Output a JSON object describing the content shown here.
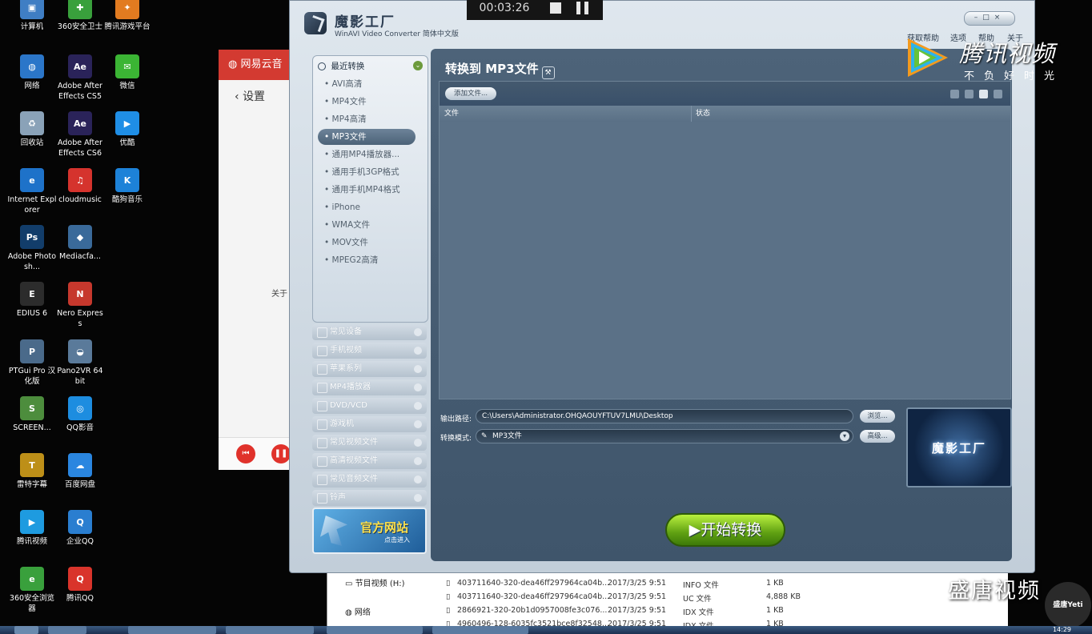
{
  "desktop": {
    "icons": [
      {
        "label": "计算机",
        "color": "#3f7ec4",
        "glyph": "▣"
      },
      {
        "label": "360安全卫士",
        "color": "#39a03c",
        "glyph": "✚"
      },
      {
        "label": "腾讯游戏平台",
        "color": "#e27b20",
        "glyph": "✦"
      },
      {
        "label": "网络",
        "color": "#2b76c9",
        "glyph": "◍"
      },
      {
        "label": "Adobe After Effects CS5",
        "color": "#2a2359",
        "glyph": "Ae"
      },
      {
        "label": "微信",
        "color": "#3bb534",
        "glyph": "✉"
      },
      {
        "label": "回收站",
        "color": "#8aa2b8",
        "glyph": "♻"
      },
      {
        "label": "Adobe After Effects CS6",
        "color": "#2a2359",
        "glyph": "Ae"
      },
      {
        "label": "优酷",
        "color": "#1f8ee6",
        "glyph": "▶"
      },
      {
        "label": "Internet Explorer",
        "color": "#1e72c9",
        "glyph": "e"
      },
      {
        "label": "cloudmusic",
        "color": "#d5332d",
        "glyph": "♫"
      },
      {
        "label": "酷狗音乐",
        "color": "#1d82d8",
        "glyph": "K"
      },
      {
        "label": "Adobe Photosh...",
        "color": "#123d6a",
        "glyph": "Ps"
      },
      {
        "label": "Mediacfa...",
        "color": "#3a6a9a",
        "glyph": "◆"
      },
      {
        "label": "EDIUS 6",
        "color": "#2c2c2c",
        "glyph": "E"
      },
      {
        "label": "Nero Express",
        "color": "#c6382d",
        "glyph": "N"
      },
      {
        "label": "PTGui Pro 汉化版",
        "color": "#4a6a8a",
        "glyph": "P"
      },
      {
        "label": "Pano2VR 64bit",
        "color": "#5a7a9a",
        "glyph": "◒"
      },
      {
        "label": "SCREEN...",
        "color": "#4d8d3d",
        "glyph": "S"
      },
      {
        "label": "QQ影音",
        "color": "#1d8de0",
        "glyph": "◎"
      },
      {
        "label": "雷特字幕",
        "color": "#bd8f18",
        "glyph": "T"
      },
      {
        "label": "百度网盘",
        "color": "#2a86e0",
        "glyph": "☁"
      },
      {
        "label": "腾讯视频",
        "color": "#1e9be0",
        "glyph": "▶"
      },
      {
        "label": "企业QQ",
        "color": "#2a7ed0",
        "glyph": "Q"
      },
      {
        "label": "360安全浏览器",
        "color": "#39a03c",
        "glyph": "e"
      },
      {
        "label": "腾讯QQ",
        "color": "#d9342b",
        "glyph": "Q"
      }
    ]
  },
  "netease": {
    "brand": "网易云音",
    "back_label": "设置",
    "about": "关于"
  },
  "recorder": {
    "time": "00:03:26"
  },
  "app": {
    "title_zh": "魔影工厂",
    "title_en": "WinAVI Video Converter 简体中文版",
    "menu": [
      "获取帮助",
      "选项",
      "帮助",
      "关于"
    ],
    "recent_header": "最近转换",
    "recent_items": [
      "AVI高清",
      "MP4文件",
      "MP4高清",
      "MP3文件",
      "通用MP4播放器...",
      "通用手机3GP格式",
      "通用手机MP4格式",
      "iPhone",
      "WMA文件",
      "MOV文件",
      "MPEG2高清"
    ],
    "selected_recent": "MP3文件",
    "categories": [
      "常见设备",
      "手机视频",
      "苹果系列",
      "MP4播放器",
      "DVD/VCD",
      "游戏机",
      "常见视频文件",
      "高清视频文件",
      "常见音频文件",
      "铃声"
    ],
    "banner_title": "官方网站",
    "banner_sub": "点击进入",
    "panel_title": "转换到 MP3文件",
    "add_file_label": "添加文件...",
    "col_file": "文件",
    "col_status": "状态",
    "output_label": "输出路径:",
    "output_path": "C:\\Users\\Administrator.OHQAOUYFTUV7LMU\\Desktop",
    "browse_label": "浏览...",
    "mode_label": "转换模式:",
    "mode_value": "MP3文件",
    "advanced_label": "高级...",
    "preview_text": "魔影工厂",
    "start_label": "开始转换"
  },
  "explorer": {
    "nav": [
      "节目视频 (H:)",
      "网络"
    ],
    "rows": [
      {
        "name": "403711640-320-dea46ff297964ca04b...",
        "date": "2017/3/25 9:51",
        "type": "INFO 文件",
        "size": "1 KB"
      },
      {
        "name": "403711640-320-dea46ff297964ca04b...",
        "date": "2017/3/25 9:51",
        "type": "UC 文件",
        "size": "4,888 KB"
      },
      {
        "name": "2866921-320-20b1d0957008fe3c076...",
        "date": "2017/3/25 9:51",
        "type": "IDX 文件",
        "size": "1 KB"
      },
      {
        "name": "4960496-128-6035fc3521bce8f32548...",
        "date": "2017/3/25 9:51",
        "type": "IDX 文件",
        "size": "1 KB"
      }
    ]
  },
  "taskbar": {
    "clock": "14:29"
  },
  "watermarks": {
    "tencent_title": "腾讯视频",
    "tencent_slogan": "不负好时光",
    "shengtang": "盛唐视频",
    "corner": "盛唐Yeti"
  }
}
